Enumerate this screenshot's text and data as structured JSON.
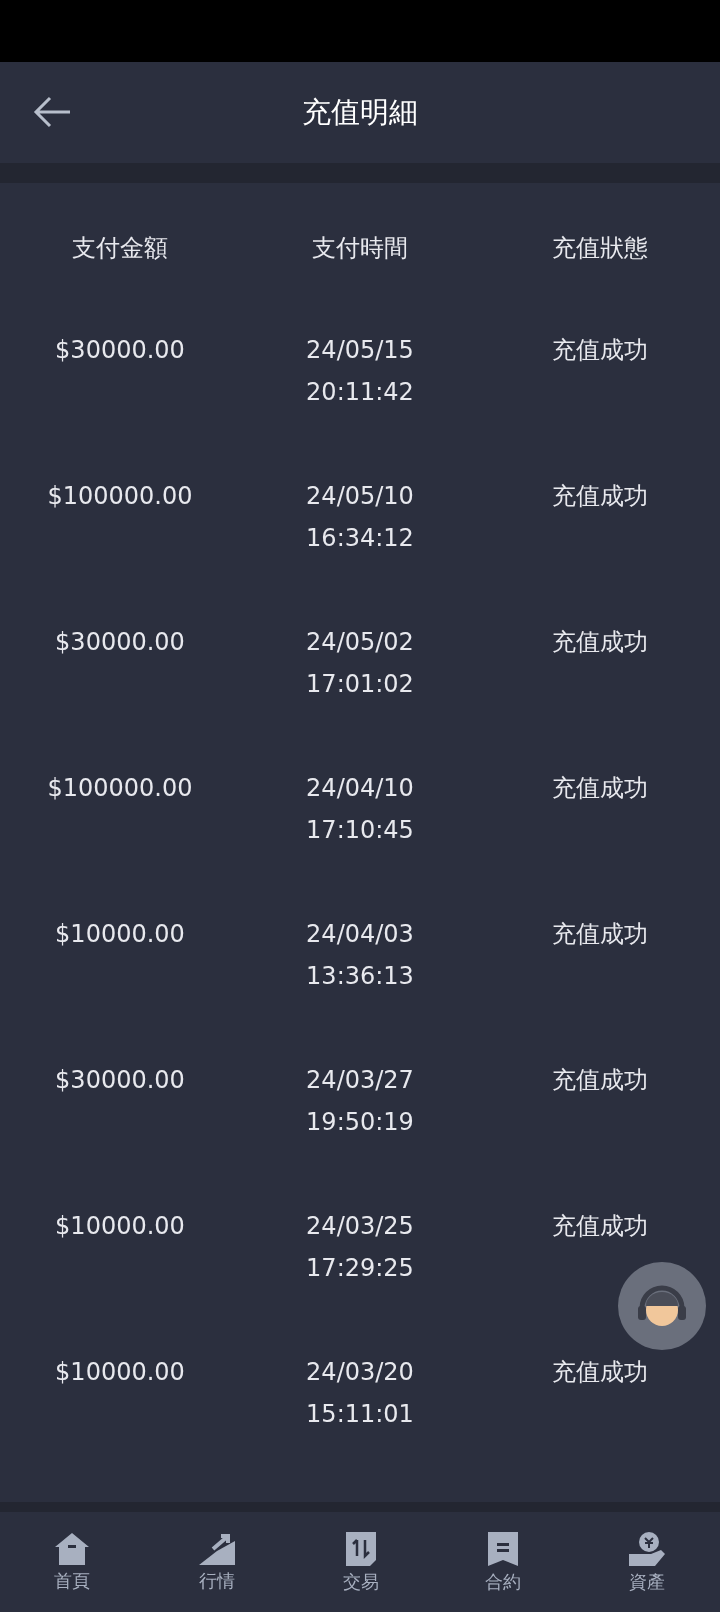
{
  "header": {
    "title": "充值明細"
  },
  "table": {
    "columns": [
      "支付金額",
      "支付時間",
      "充值狀態"
    ],
    "rows": [
      {
        "amount": "$30000.00",
        "date": "24/05/15",
        "time": "20:11:42",
        "status": "充值成功"
      },
      {
        "amount": "$100000.00",
        "date": "24/05/10",
        "time": "16:34:12",
        "status": "充值成功"
      },
      {
        "amount": "$30000.00",
        "date": "24/05/02",
        "time": "17:01:02",
        "status": "充值成功"
      },
      {
        "amount": "$100000.00",
        "date": "24/04/10",
        "time": "17:10:45",
        "status": "充值成功"
      },
      {
        "amount": "$10000.00",
        "date": "24/04/03",
        "time": "13:36:13",
        "status": "充值成功"
      },
      {
        "amount": "$30000.00",
        "date": "24/03/27",
        "time": "19:50:19",
        "status": "充值成功"
      },
      {
        "amount": "$10000.00",
        "date": "24/03/25",
        "time": "17:29:25",
        "status": "充值成功"
      },
      {
        "amount": "$10000.00",
        "date": "24/03/20",
        "time": "15:11:01",
        "status": "充值成功"
      }
    ]
  },
  "bottom_nav": [
    {
      "kind": "home",
      "label": "首頁"
    },
    {
      "kind": "market",
      "label": "行情"
    },
    {
      "kind": "trade",
      "label": "交易"
    },
    {
      "kind": "contract",
      "label": "合約"
    },
    {
      "kind": "assets",
      "label": "資產"
    }
  ]
}
